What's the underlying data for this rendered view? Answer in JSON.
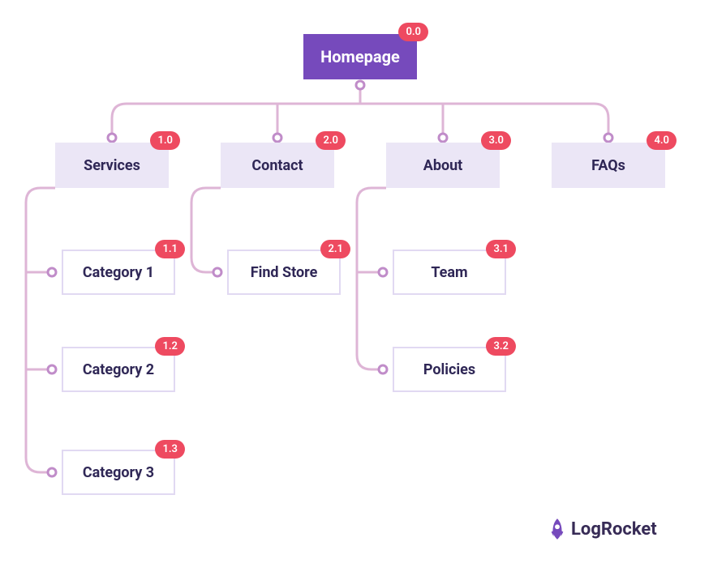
{
  "brand": {
    "name": "LogRocket"
  },
  "nodes": {
    "root": {
      "label": "Homepage",
      "badge": "0.0"
    },
    "services": {
      "label": "Services",
      "badge": "1.0"
    },
    "contact": {
      "label": "Contact",
      "badge": "2.0"
    },
    "about": {
      "label": "About",
      "badge": "3.0"
    },
    "faqs": {
      "label": "FAQs",
      "badge": "4.0"
    },
    "cat1": {
      "label": "Category 1",
      "badge": "1.1"
    },
    "cat2": {
      "label": "Category 2",
      "badge": "1.2"
    },
    "cat3": {
      "label": "Category 3",
      "badge": "1.3"
    },
    "findstore": {
      "label": "Find Store",
      "badge": "2.1"
    },
    "team": {
      "label": "Team",
      "badge": "3.1"
    },
    "policies": {
      "label": "Policies",
      "badge": "3.2"
    }
  },
  "colors": {
    "root_bg": "#764abc",
    "l1_bg": "#ebe6f6",
    "l2_border": "#e1d9f2",
    "badge_bg": "#ee4a60",
    "text": "#2f2756",
    "connector": "#e4b8d9",
    "connector_dark": "#bc87c6"
  }
}
